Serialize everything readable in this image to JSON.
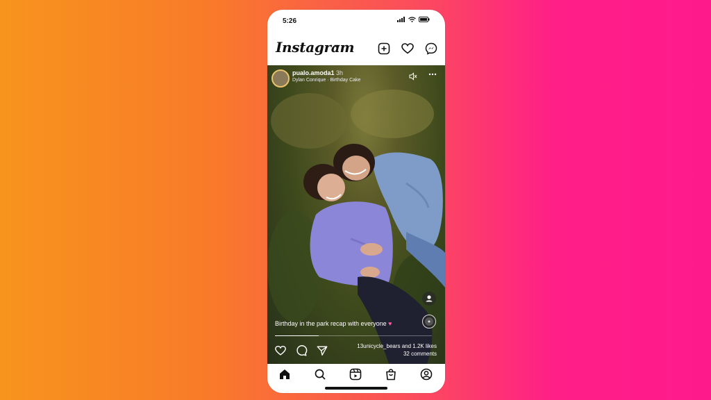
{
  "status_bar": {
    "time": "5:26",
    "icons": [
      "signal-icon",
      "wifi-icon",
      "battery-icon"
    ]
  },
  "header": {
    "logo": "Instagram",
    "icons": [
      "chevron-down-icon",
      "new-post-icon",
      "heart-icon",
      "messenger-icon"
    ]
  },
  "post": {
    "username": "pualo.amoda1",
    "time_ago": "3h",
    "audio": "Dylan Conrique · Birthday Cake",
    "caption": "Birthday in the park recap with everyone",
    "caption_emoji": "♥",
    "progress": 0.28,
    "liked_by": "13unicycle_bears and 1.2K likes",
    "comments": "32 comments"
  },
  "tabbar": {
    "items": [
      "home-icon",
      "search-icon",
      "reels-icon",
      "shop-icon",
      "profile-icon"
    ]
  },
  "colors": {
    "background_left": "#f7941d",
    "background_right": "#ff1a8c",
    "caption_heart": "#ff5aa5"
  }
}
